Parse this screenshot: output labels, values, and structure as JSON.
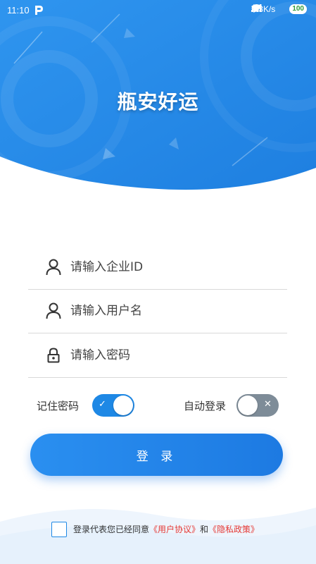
{
  "status_bar": {
    "time": "11:10",
    "network_speed": "6.3K/s",
    "battery": "100",
    "icons": [
      "p-app-icon",
      "bluetooth-icon",
      "signal-icon",
      "wifi-icon",
      "battery-icon",
      "charging-icon"
    ]
  },
  "header": {
    "app_title": "瓶安好运"
  },
  "form": {
    "company_id_placeholder": "请输入企业ID",
    "username_placeholder": "请输入用户名",
    "password_placeholder": "请输入密码"
  },
  "options": {
    "remember_label": "记住密码",
    "remember_on": true,
    "auto_login_label": "自动登录",
    "auto_login_on": false
  },
  "login_button": "登 录",
  "agreement": {
    "prefix": "登录代表您已经同意",
    "user_agreement": "《用户协议》",
    "and": "和",
    "privacy_policy": "《隐私政策》"
  },
  "colors": {
    "primary": "#1e88e5",
    "toggle_off": "#7e8c98",
    "link_red": "#e53935"
  }
}
